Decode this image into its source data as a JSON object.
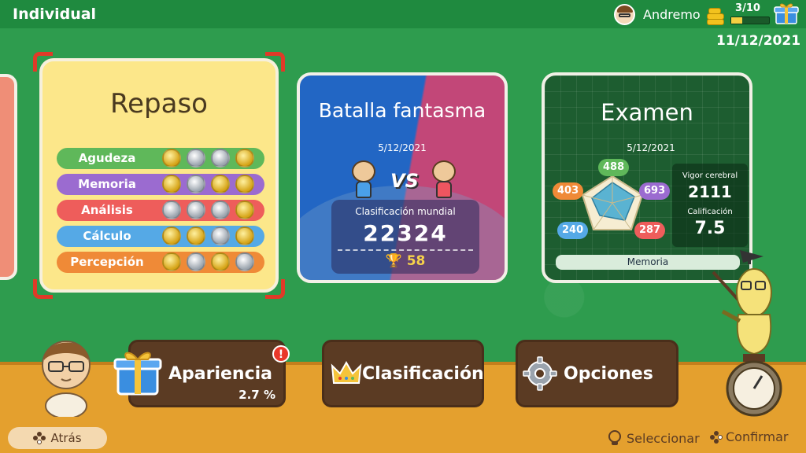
{
  "header": {
    "mode_title": "Individual",
    "username": "Andremo",
    "gift_progress_text": "3/10",
    "gift_progress_fraction": 0.3,
    "date": "11/12/2021"
  },
  "repaso": {
    "title": "Repaso",
    "stats": [
      {
        "label": "Agudeza",
        "color": "#5fb85a",
        "medals": [
          "gold",
          "silver",
          "silver",
          "gold"
        ]
      },
      {
        "label": "Memoria",
        "color": "#9b6bd0",
        "medals": [
          "gold",
          "silver",
          "gold",
          "gold"
        ]
      },
      {
        "label": "Análisis",
        "color": "#ee5d5b",
        "medals": [
          "silver",
          "silver",
          "silver",
          "gold"
        ]
      },
      {
        "label": "Cálculo",
        "color": "#55a9e6",
        "medals": [
          "gold",
          "gold",
          "silver",
          "gold"
        ]
      },
      {
        "label": "Percepción",
        "color": "#ef8a37",
        "medals": [
          "gold",
          "silver",
          "gold",
          "silver"
        ]
      }
    ]
  },
  "batalla": {
    "title": "Batalla fantasma",
    "date": "5/12/2021",
    "vs_label": "VS",
    "ranking_label": "Clasificación mundial",
    "ranking_value": "22324",
    "trophies": "58"
  },
  "examen": {
    "title": "Examen",
    "date": "5/12/2021",
    "scores": [
      {
        "value": "488",
        "color": "#5fb85a"
      },
      {
        "value": "693",
        "color": "#9b6bd0"
      },
      {
        "value": "287",
        "color": "#ee5d5b"
      },
      {
        "value": "240",
        "color": "#55a9e6"
      },
      {
        "value": "403",
        "color": "#ef8a37"
      }
    ],
    "vigor_label": "Vigor cerebral",
    "vigor_value": "2111",
    "calificacion_label": "Calificación",
    "calificacion_value": "7.5",
    "focus_label": "Memoria"
  },
  "menu": {
    "apariencia_label": "Apariencia",
    "apariencia_pct": "2.7 %",
    "alert": "!",
    "clasificacion_label": "Clasificación",
    "opciones_label": "Opciones"
  },
  "footer": {
    "back_label": "Atrás",
    "select_label": "Seleccionar",
    "confirm_label": "Confirmar"
  }
}
